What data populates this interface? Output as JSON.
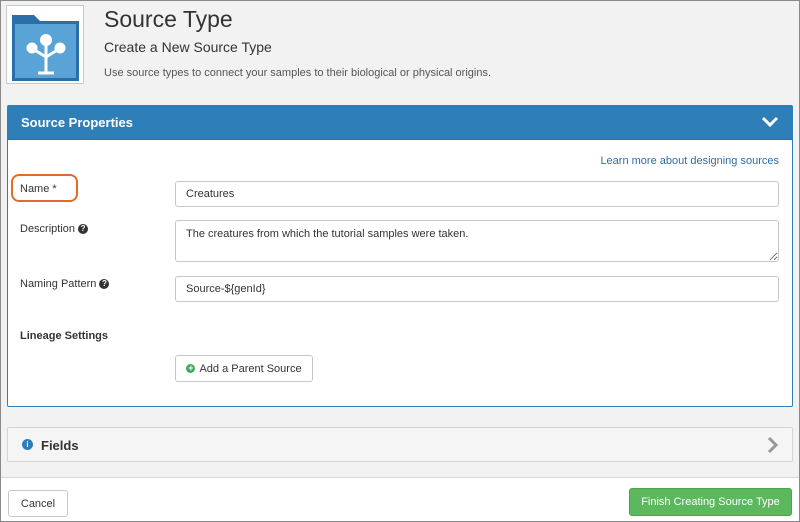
{
  "header": {
    "title": "Source Type",
    "subtitle": "Create a New Source Type",
    "description": "Use source types to connect your samples to their biological or physical origins."
  },
  "source_properties": {
    "heading": "Source Properties",
    "learn_more_link": "Learn more about designing sources",
    "name_label": "Name *",
    "name_value": "Creatures",
    "description_label": "Description",
    "description_value": "The creatures from which the tutorial samples were taken.",
    "naming_pattern_label": "Naming Pattern",
    "naming_pattern_value": "Source-${genId}",
    "lineage_label": "Lineage Settings",
    "add_parent_button": "Add a Parent Source"
  },
  "fields_panel": {
    "heading": "Fields"
  },
  "footer": {
    "cancel_button": "Cancel",
    "finish_button": "Finish Creating Source Type"
  },
  "icons": {
    "logo": "source-type-logo-icon",
    "collapse": "chevron-down-icon",
    "expand": "chevron-right-icon",
    "help": "help-circle-icon",
    "info": "info-circle-icon",
    "add": "plus-circle-icon"
  },
  "colors": {
    "panel_header": "#2e7fb8",
    "finish_button": "#5cb85c",
    "highlight": "#e06b2c"
  }
}
